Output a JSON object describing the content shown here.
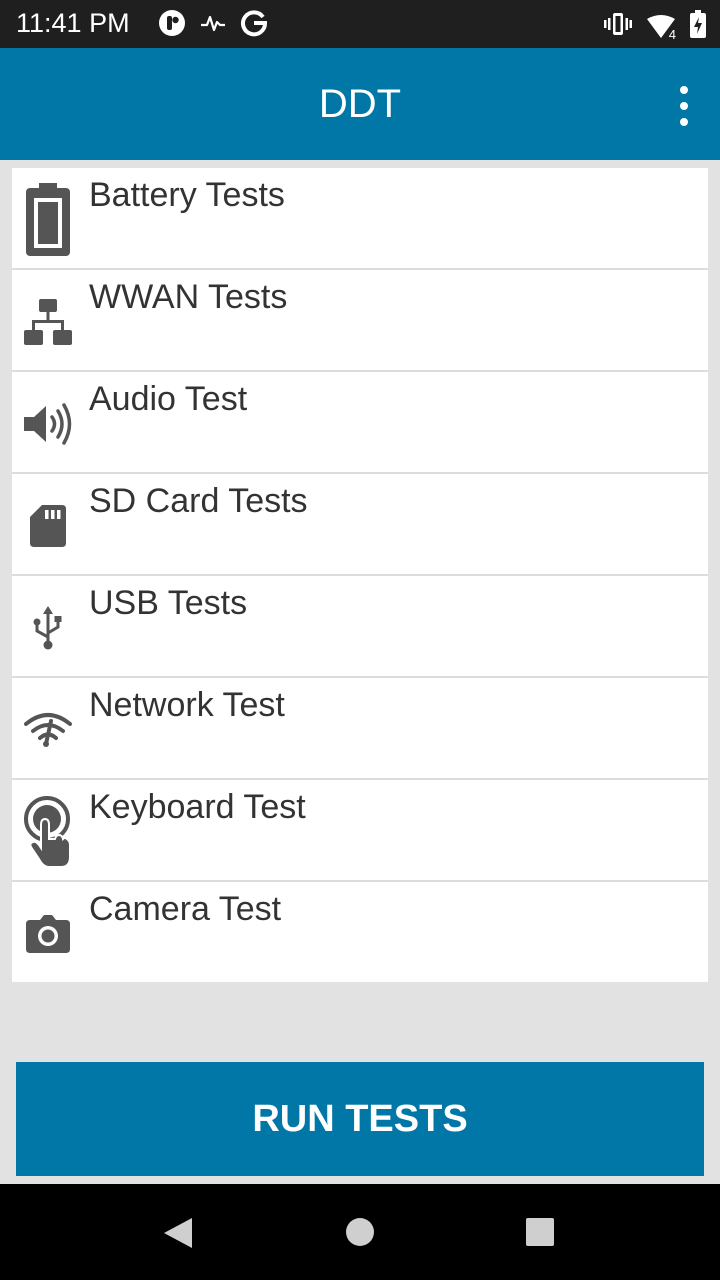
{
  "status_bar": {
    "time": "11:41 PM",
    "left_icons": [
      "notification-app-icon",
      "activity-icon",
      "google-icon"
    ],
    "right_icons": [
      "vibrate-icon",
      "signal-icon",
      "battery-icon"
    ],
    "signal_label": "4"
  },
  "app_bar": {
    "title": "DDT",
    "menu_icon": "more-vert-icon"
  },
  "tests": [
    {
      "label": "Battery Tests",
      "icon": "battery-icon"
    },
    {
      "label": "WWAN Tests",
      "icon": "network-tree-icon"
    },
    {
      "label": "Audio Test",
      "icon": "speaker-icon"
    },
    {
      "label": "SD Card Tests",
      "icon": "sd-card-icon"
    },
    {
      "label": "USB Tests",
      "icon": "usb-icon"
    },
    {
      "label": "Network Test",
      "icon": "wifi-icon"
    },
    {
      "label": "Keyboard Test",
      "icon": "touch-icon"
    },
    {
      "label": "Camera Test",
      "icon": "camera-icon"
    }
  ],
  "run_button": {
    "label": "RUN TESTS"
  },
  "colors": {
    "primary": "#0077a6",
    "status_bar": "#1f1f1f",
    "background": "#e2e2e2",
    "icon": "#555555"
  },
  "nav_bar": {
    "icons": [
      "back-icon",
      "home-icon",
      "recents-icon"
    ]
  }
}
